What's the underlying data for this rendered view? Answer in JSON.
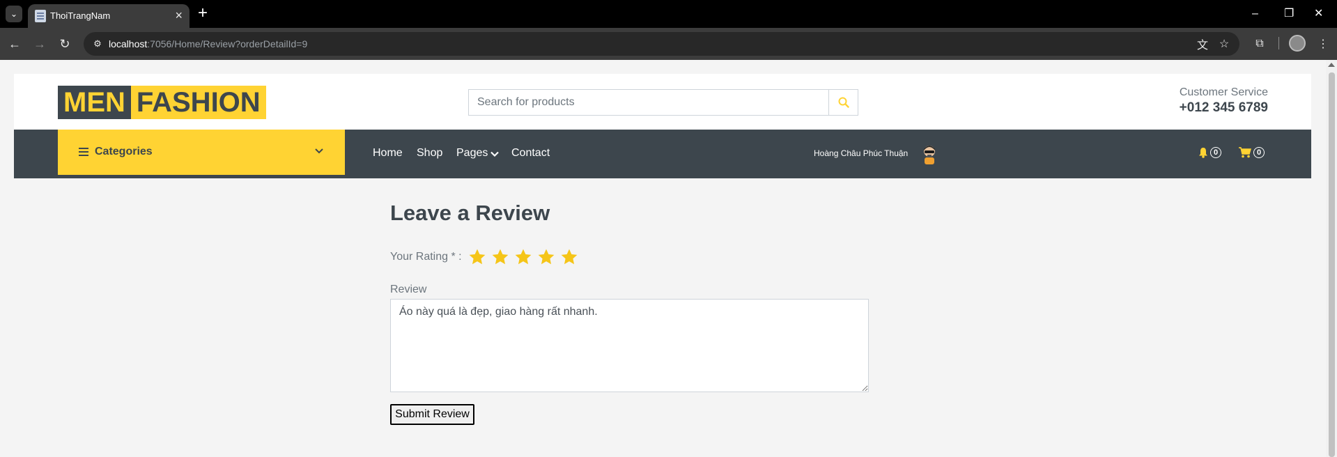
{
  "browser": {
    "tab_title": "ThoiTrangNam",
    "url_host": "localhost",
    "url_rest": ":7056/Home/Review?orderDetailId=9",
    "icons": [
      "tab-search-icon",
      "favicon",
      "close-icon",
      "new-tab-icon",
      "minimize-icon",
      "restore-icon",
      "close-window-icon",
      "back-icon",
      "forward-icon",
      "reload-icon",
      "site-info-icon",
      "translate-icon",
      "bookmark-star-icon",
      "extensions-icon",
      "profile-avatar",
      "menu-icon"
    ]
  },
  "header": {
    "logo_left": "MEN",
    "logo_right": "FASHION",
    "search_placeholder": "Search for products",
    "cs_label": "Customer Service",
    "cs_phone": "+012 345 6789"
  },
  "nav": {
    "categories": "Categories",
    "links": [
      "Home",
      "Shop",
      "Pages",
      "Contact"
    ],
    "user_name": "Hoàng Châu Phúc Thuận",
    "notification_count": "0",
    "cart_count": "0"
  },
  "review": {
    "title": "Leave a Review",
    "rating_label": "Your Rating * :",
    "rating": 5,
    "max_rating": 5,
    "review_label": "Review",
    "review_text": "Áo này quá là đẹp, giao hàng rất nhanh.",
    "submit_label": "Submit Review"
  },
  "colors": {
    "primary": "#ffd333",
    "dark": "#3d464d",
    "star": "#f5c518"
  }
}
